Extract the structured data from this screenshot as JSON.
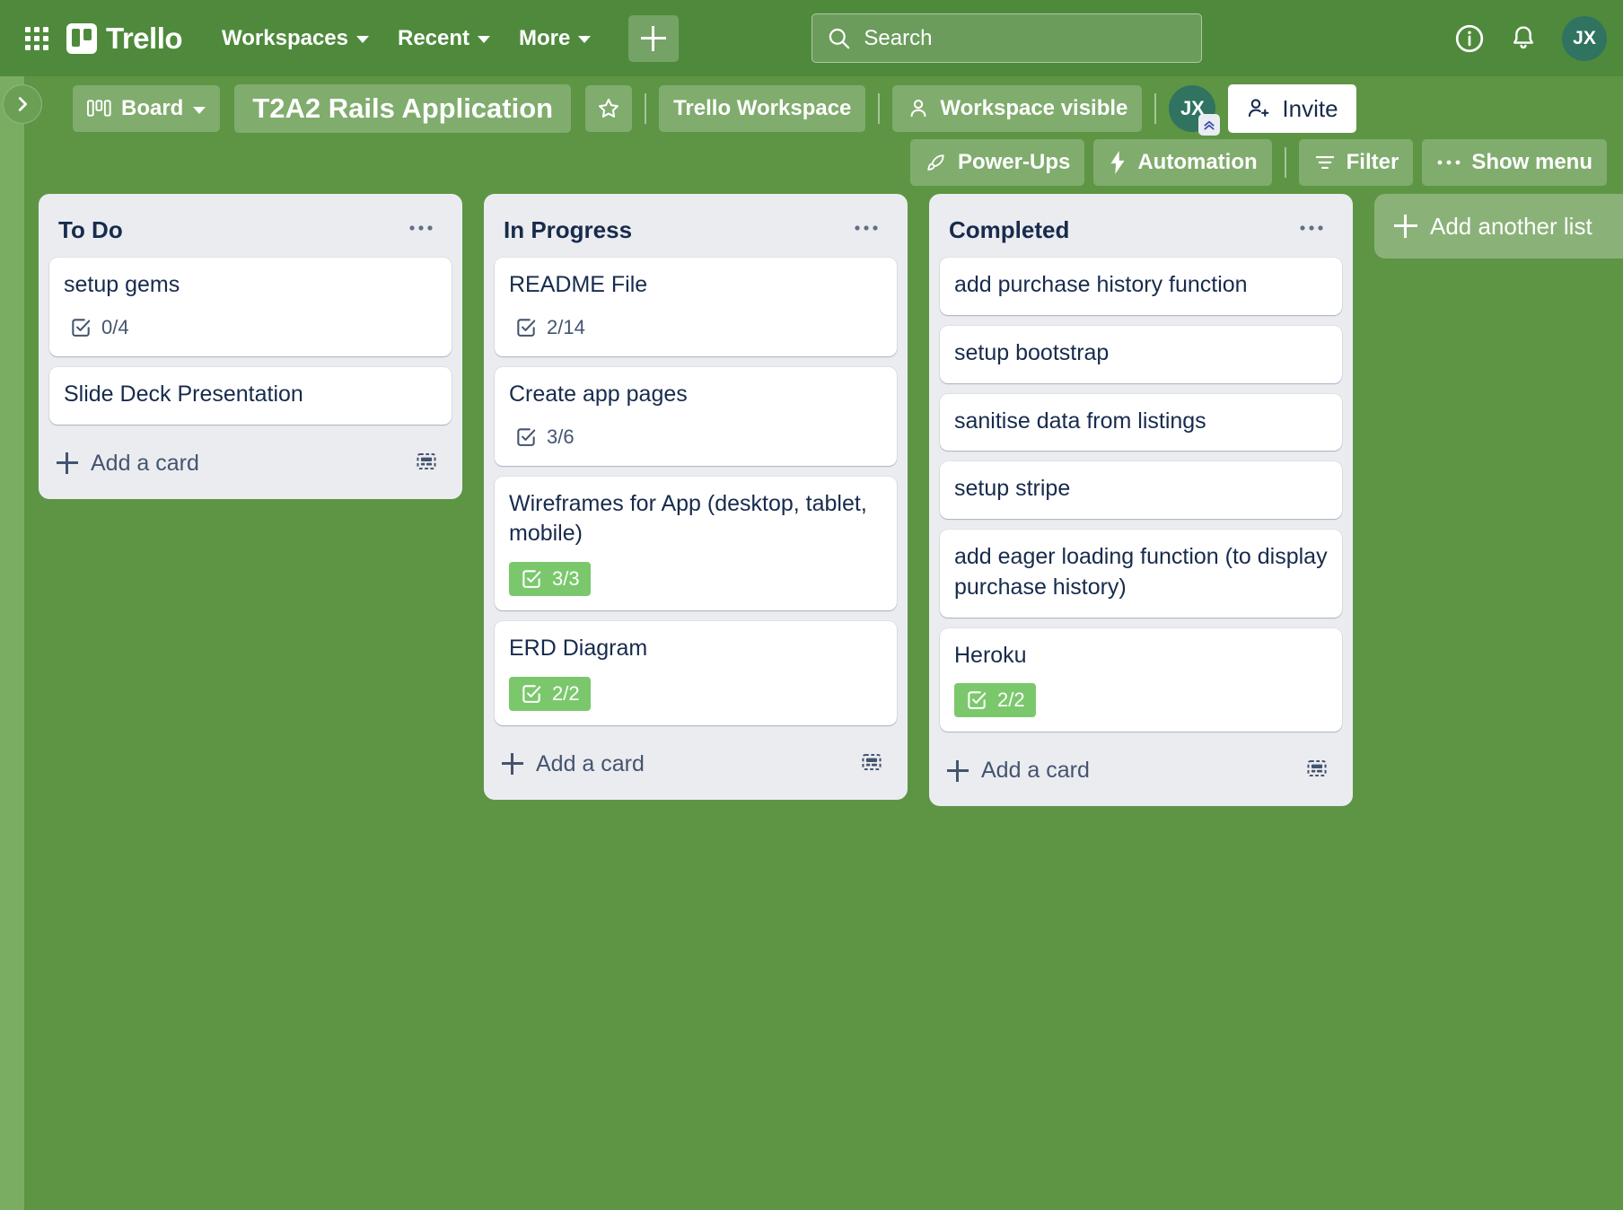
{
  "top_nav": {
    "apps_icon": "grid-apps-icon",
    "logo_text": "Trello",
    "menus": [
      {
        "label": "Workspaces",
        "icon": "chevron-down-icon"
      },
      {
        "label": "Recent",
        "icon": "chevron-down-icon"
      },
      {
        "label": "More",
        "icon": "chevron-down-icon"
      }
    ],
    "create_button_icon": "plus-icon",
    "search": {
      "placeholder": "Search",
      "icon": "search-icon",
      "value": ""
    },
    "info_icon": "info-circle-icon",
    "notifications_icon": "bell-icon",
    "avatar_initials": "JX"
  },
  "board_header": {
    "sidebar_toggle_icon": "chevron-right-icon",
    "view_button": {
      "label": "Board",
      "icon": "board-view-icon",
      "chevron": "chevron-down-icon"
    },
    "title": "T2A2 Rails Application",
    "star_icon": "star-outline-icon",
    "workspace_button": "Trello Workspace",
    "visibility_button": {
      "label": "Workspace visible",
      "icon": "person-icon"
    },
    "member_avatar": "JX",
    "premium_badge_icon": "double-chevron-up-icon",
    "invite_button": {
      "label": "Invite",
      "icon": "person-add-icon"
    },
    "actions": [
      {
        "label": "Power-Ups",
        "icon": "rocket-icon"
      },
      {
        "label": "Automation",
        "icon": "lightning-bolt-icon"
      },
      {
        "label": "Filter",
        "icon": "filter-icon"
      },
      {
        "label": "Show menu",
        "icon": "ellipsis-icon"
      }
    ]
  },
  "board": {
    "add_list_label": "+ Add another list",
    "list_menu_icon": "ellipsis-icon",
    "add_card_label": "Add a card",
    "add_card_icon": "plus-icon",
    "card_template_icon": "card-template-icon",
    "checklist_icon": "checklist-icon",
    "complete_badge_color": "#7bc86c",
    "lists": [
      {
        "title": "To Do",
        "cards": [
          {
            "title": "setup gems",
            "checklist": "0/4",
            "complete": false
          },
          {
            "title": "Slide Deck Presentation",
            "checklist": null,
            "complete": false
          }
        ]
      },
      {
        "title": "In Progress",
        "cards": [
          {
            "title": "README File",
            "checklist": "2/14",
            "complete": false
          },
          {
            "title": "Create app pages",
            "checklist": "3/6",
            "complete": false
          },
          {
            "title": "Wireframes for App (desktop, tablet, mobile)",
            "checklist": "3/3",
            "complete": true
          },
          {
            "title": "ERD Diagram",
            "checklist": "2/2",
            "complete": true
          }
        ]
      },
      {
        "title": "Completed",
        "cards": [
          {
            "title": "add purchase history function",
            "checklist": null,
            "complete": false
          },
          {
            "title": "setup bootstrap",
            "checklist": null,
            "complete": false
          },
          {
            "title": "sanitise data from listings",
            "checklist": null,
            "complete": false
          },
          {
            "title": "setup stripe",
            "checklist": null,
            "complete": false
          },
          {
            "title": "add eager loading function (to display purchase history)",
            "checklist": null,
            "complete": false
          },
          {
            "title": "Heroku",
            "checklist": "2/2",
            "complete": true
          }
        ]
      }
    ]
  },
  "colors": {
    "board_background": "#5d9544",
    "nav_background": "#4f8a3c",
    "sidebar_strip": "#7aad62",
    "list_background": "#ebecf0",
    "card_background": "#ffffff",
    "text_dark": "#172b4d",
    "text_muted": "#44546f",
    "complete_green": "#7bc86c",
    "avatar_teal": "#2f7360"
  }
}
